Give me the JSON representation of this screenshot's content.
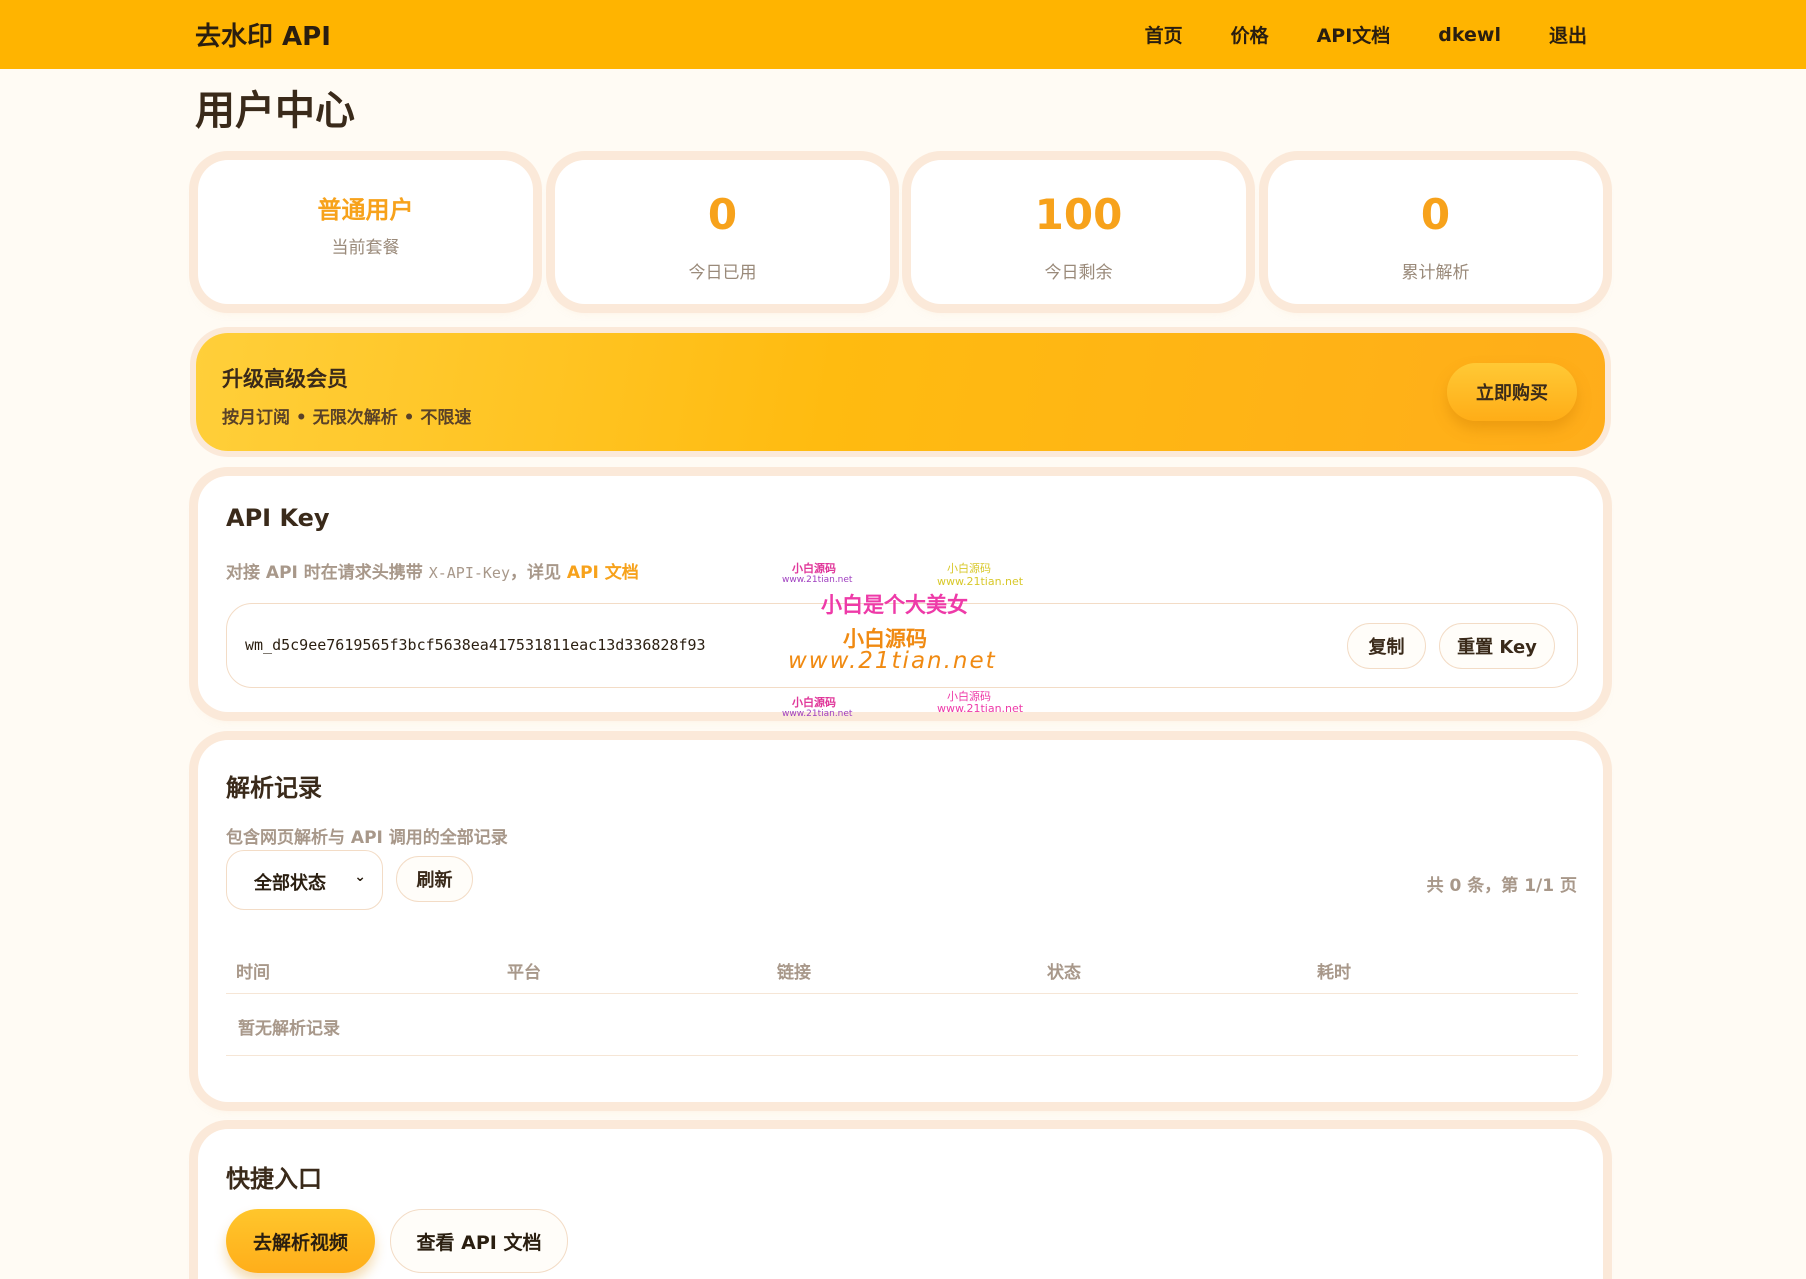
{
  "header": {
    "brand": "去水印 API",
    "nav": [
      "首页",
      "价格",
      "API文档",
      "dkewl",
      "退出"
    ]
  },
  "page_title": "用户中心",
  "stats": {
    "plan_name": "普通用户",
    "plan_label": "当前套餐",
    "today_used": "0",
    "today_used_label": "今日已用",
    "today_left": "100",
    "today_left_label": "今日剩余",
    "total": "0",
    "total_label": "累计解析"
  },
  "upgrade": {
    "title": "升级高级会员",
    "subtitle": "按月订阅 • 无限次解析 • 不限速",
    "button": "立即购买"
  },
  "api_key": {
    "title": "API Key",
    "desc_prefix": "对接 API 时在请求头携带 ",
    "desc_header": "X-API-Key",
    "desc_mid": "，详见 ",
    "desc_link": "API 文档",
    "key": "wm_d5c9ee7619565f3bcf5638ea417531811eac13d336828f93",
    "copy_button": "复制",
    "reset_button": "重置 Key"
  },
  "records": {
    "title": "解析记录",
    "subtitle": "包含网页解析与 API 调用的全部记录",
    "filter_value": "全部状态",
    "refresh_button": "刷新",
    "count_text": "共 0 条，第 1/1 页",
    "columns": [
      "时间",
      "平台",
      "链接",
      "状态",
      "耗时"
    ],
    "empty_text": "暂无解析记录"
  },
  "shortcuts": {
    "title": "快捷入口",
    "primary": "去解析视频",
    "secondary": "查看 API 文档"
  },
  "watermark": {
    "main": "小白是个大美女",
    "line2": "小白源码",
    "line3": "www.21tian.net",
    "small_a": "小白源码",
    "small_b": "www.21tian.net"
  },
  "colors": {
    "accent": "#ffb400",
    "number": "#f7a21b",
    "background": "#fffbf4"
  }
}
